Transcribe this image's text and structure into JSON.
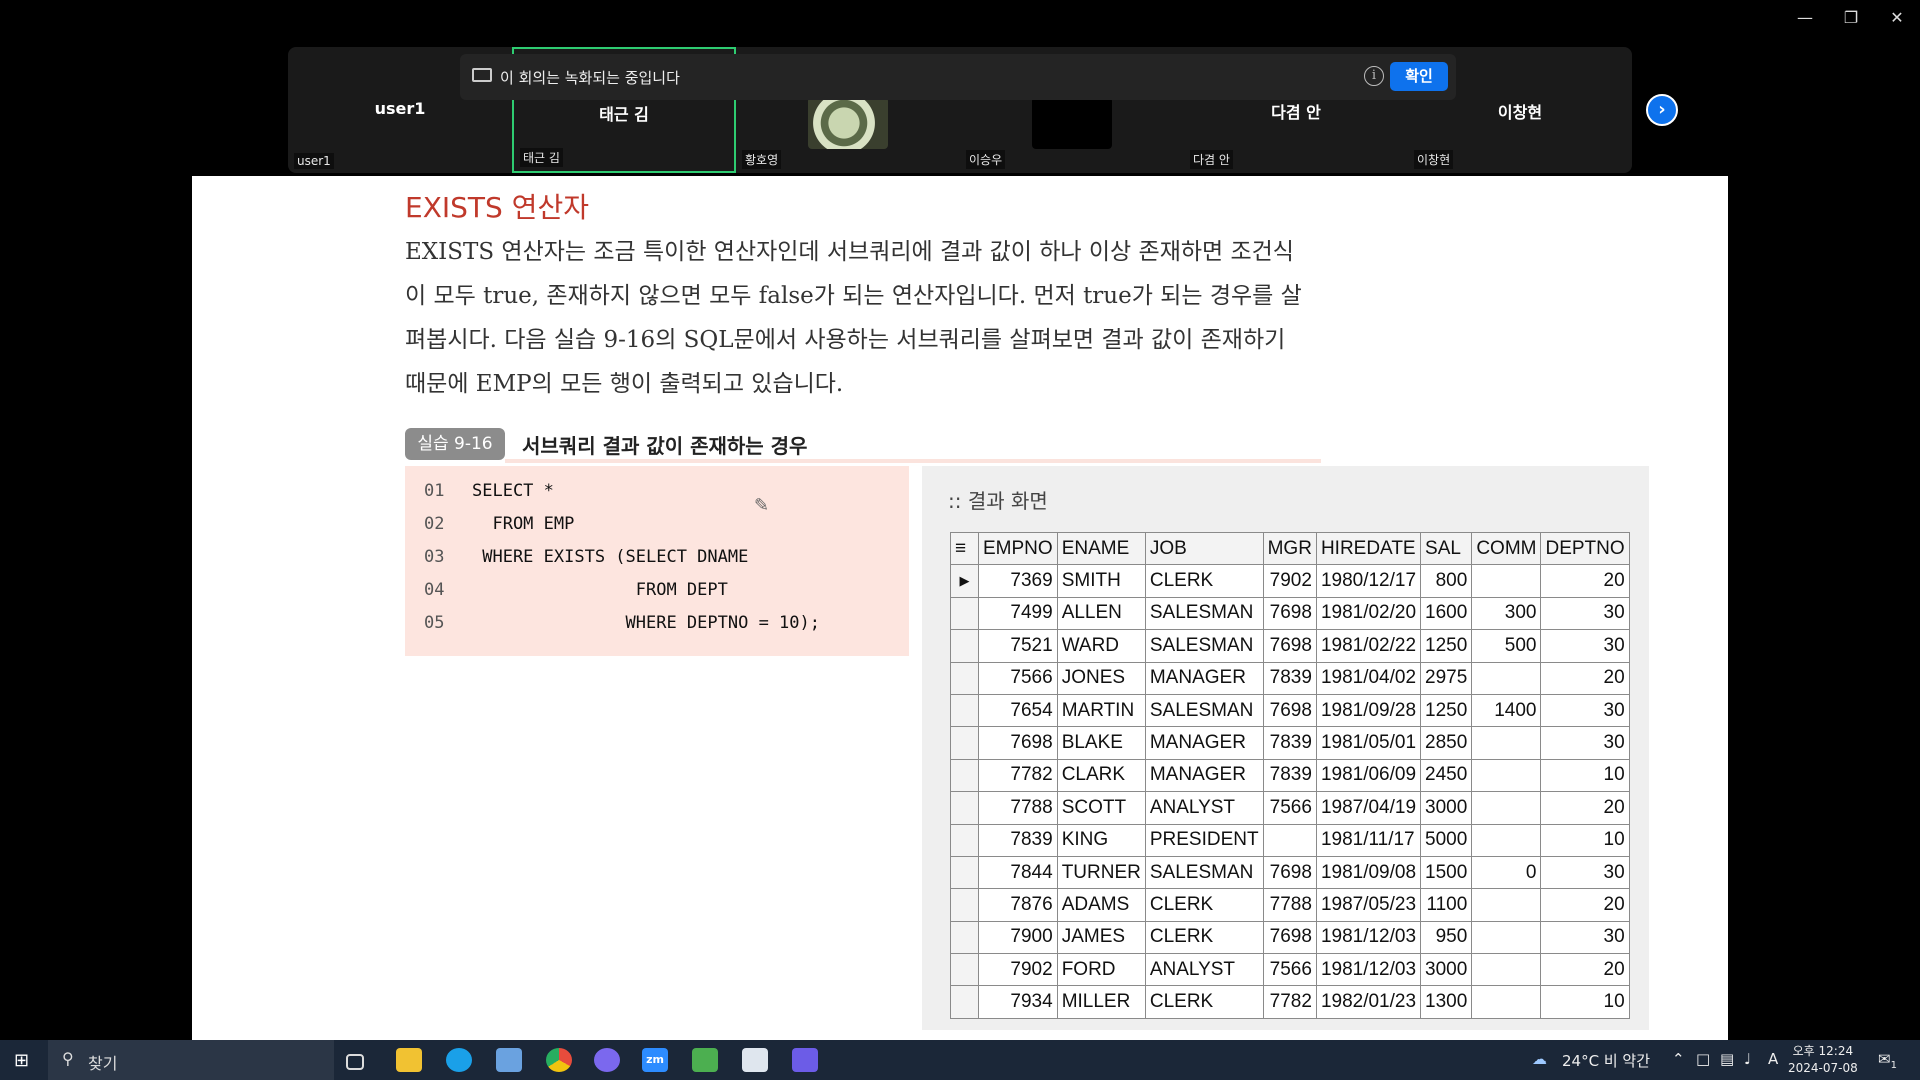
{
  "window": {
    "minimize_icon": "minimize-icon",
    "restore_icon": "restore-icon",
    "close_icon": "close-icon"
  },
  "meeting": {
    "recording_banner": {
      "text": "이 회의는 녹화되는 중입니다",
      "confirm_label": "확인",
      "icon": "camera-icon",
      "info_icon": "info-icon"
    },
    "participants": [
      {
        "name": "user1",
        "label": "user1"
      },
      {
        "name": "태근 김",
        "label": "태근 김"
      },
      {
        "name": "",
        "label": "황호영"
      },
      {
        "name": "",
        "label": "이승우"
      },
      {
        "name": "다겸 안",
        "label": "다겸 안"
      },
      {
        "name": "이창현",
        "label": "이창현"
      }
    ],
    "next_icon": "chevron-right-icon"
  },
  "document": {
    "title": "EXISTS 연산자",
    "paragraph": [
      "EXISTS 연산자는 조금 특이한 연산자인데 서브쿼리에 결과 값이 하나 이상 존재하면 조건식",
      "이 모두 true, 존재하지 않으면 모두 false가 되는 연산자입니다. 먼저 true가 되는 경우를 살",
      "펴봅시다. 다음 실습 9-16의 SQL문에서 사용하는 서브쿼리를 살펴보면 결과 값이 존재하기",
      "때문에 EMP의 모든 행이 출력되고 있습니다."
    ],
    "practice_badge": "실습 9-16",
    "practice_title": "서브쿼리 결과 값이 존재하는 경우",
    "code": [
      {
        "ln": "01",
        "text": "SELECT *"
      },
      {
        "ln": "02",
        "text": "  FROM EMP"
      },
      {
        "ln": "03",
        "text": " WHERE EXISTS (SELECT DNAME"
      },
      {
        "ln": "04",
        "text": "                FROM DEPT"
      },
      {
        "ln": "05",
        "text": "               WHERE DEPTNO = 10);"
      }
    ],
    "result_title": ":: 결과 화면",
    "result_columns": [
      "EMPNO",
      "ENAME",
      "JOB",
      "MGR",
      "HIREDATE",
      "SAL",
      "COMM",
      "DEPTNO"
    ],
    "result_rows": [
      [
        "7369",
        "SMITH",
        "CLERK",
        "7902",
        "1980/12/17",
        "800",
        "",
        "20"
      ],
      [
        "7499",
        "ALLEN",
        "SALESMAN",
        "7698",
        "1981/02/20",
        "1600",
        "300",
        "30"
      ],
      [
        "7521",
        "WARD",
        "SALESMAN",
        "7698",
        "1981/02/22",
        "1250",
        "500",
        "30"
      ],
      [
        "7566",
        "JONES",
        "MANAGER",
        "7839",
        "1981/04/02",
        "2975",
        "",
        "20"
      ],
      [
        "7654",
        "MARTIN",
        "SALESMAN",
        "7698",
        "1981/09/28",
        "1250",
        "1400",
        "30"
      ],
      [
        "7698",
        "BLAKE",
        "MANAGER",
        "7839",
        "1981/05/01",
        "2850",
        "",
        "30"
      ],
      [
        "7782",
        "CLARK",
        "MANAGER",
        "7839",
        "1981/06/09",
        "2450",
        "",
        "10"
      ],
      [
        "7788",
        "SCOTT",
        "ANALYST",
        "7566",
        "1987/04/19",
        "3000",
        "",
        "20"
      ],
      [
        "7839",
        "KING",
        "PRESIDENT",
        "",
        "1981/11/17",
        "5000",
        "",
        "10"
      ],
      [
        "7844",
        "TURNER",
        "SALESMAN",
        "7698",
        "1981/09/08",
        "1500",
        "0",
        "30"
      ],
      [
        "7876",
        "ADAMS",
        "CLERK",
        "7788",
        "1987/05/23",
        "1100",
        "",
        "20"
      ],
      [
        "7900",
        "JAMES",
        "CLERK",
        "7698",
        "1981/12/03",
        "950",
        "",
        "30"
      ],
      [
        "7902",
        "FORD",
        "ANALYST",
        "7566",
        "1981/12/03",
        "3000",
        "",
        "20"
      ],
      [
        "7934",
        "MILLER",
        "CLERK",
        "7782",
        "1982/01/23",
        "1300",
        "",
        "10"
      ]
    ]
  },
  "taskbar": {
    "search_label": "찾기",
    "weather": "24°C  비 약간",
    "ime": "A",
    "time": "오후 12:24",
    "date": "2024-07-08",
    "notification_count": "1",
    "apps": [
      "task-view-icon",
      "file-explorer-icon",
      "edge-icon",
      "store-icon",
      "chrome-icon",
      "discord-icon",
      "zoom-icon",
      "media-icon",
      "notepad-icon",
      "app-icon"
    ]
  },
  "colors": {
    "accent_blue": "#0e72ed",
    "title_red": "#c0392b",
    "code_bg": "#fde5df",
    "active_border": "#2ecc71"
  }
}
